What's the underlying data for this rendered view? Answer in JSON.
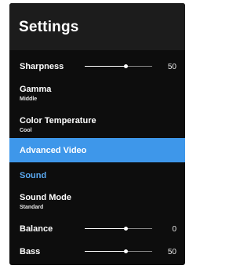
{
  "header": {
    "title": "Settings"
  },
  "menu": {
    "sharpness": {
      "label": "Sharpness",
      "value": "50",
      "level": 0.6
    },
    "gamma": {
      "label": "Gamma",
      "sub": "Middle"
    },
    "color_temperature": {
      "label": "Color Temperature",
      "sub": "Cool"
    },
    "advanced_video": {
      "label": "Advanced Video"
    },
    "sound": {
      "label": "Sound"
    },
    "sound_mode": {
      "label": "Sound Mode",
      "sub": "Standard"
    },
    "balance": {
      "label": "Balance",
      "value": "0",
      "level": 0.6
    },
    "bass": {
      "label": "Bass",
      "value": "50",
      "level": 0.6
    }
  },
  "colors": {
    "highlight": "#3e97ea",
    "section": "#5aa8f0",
    "background": "#0d0d0d"
  }
}
